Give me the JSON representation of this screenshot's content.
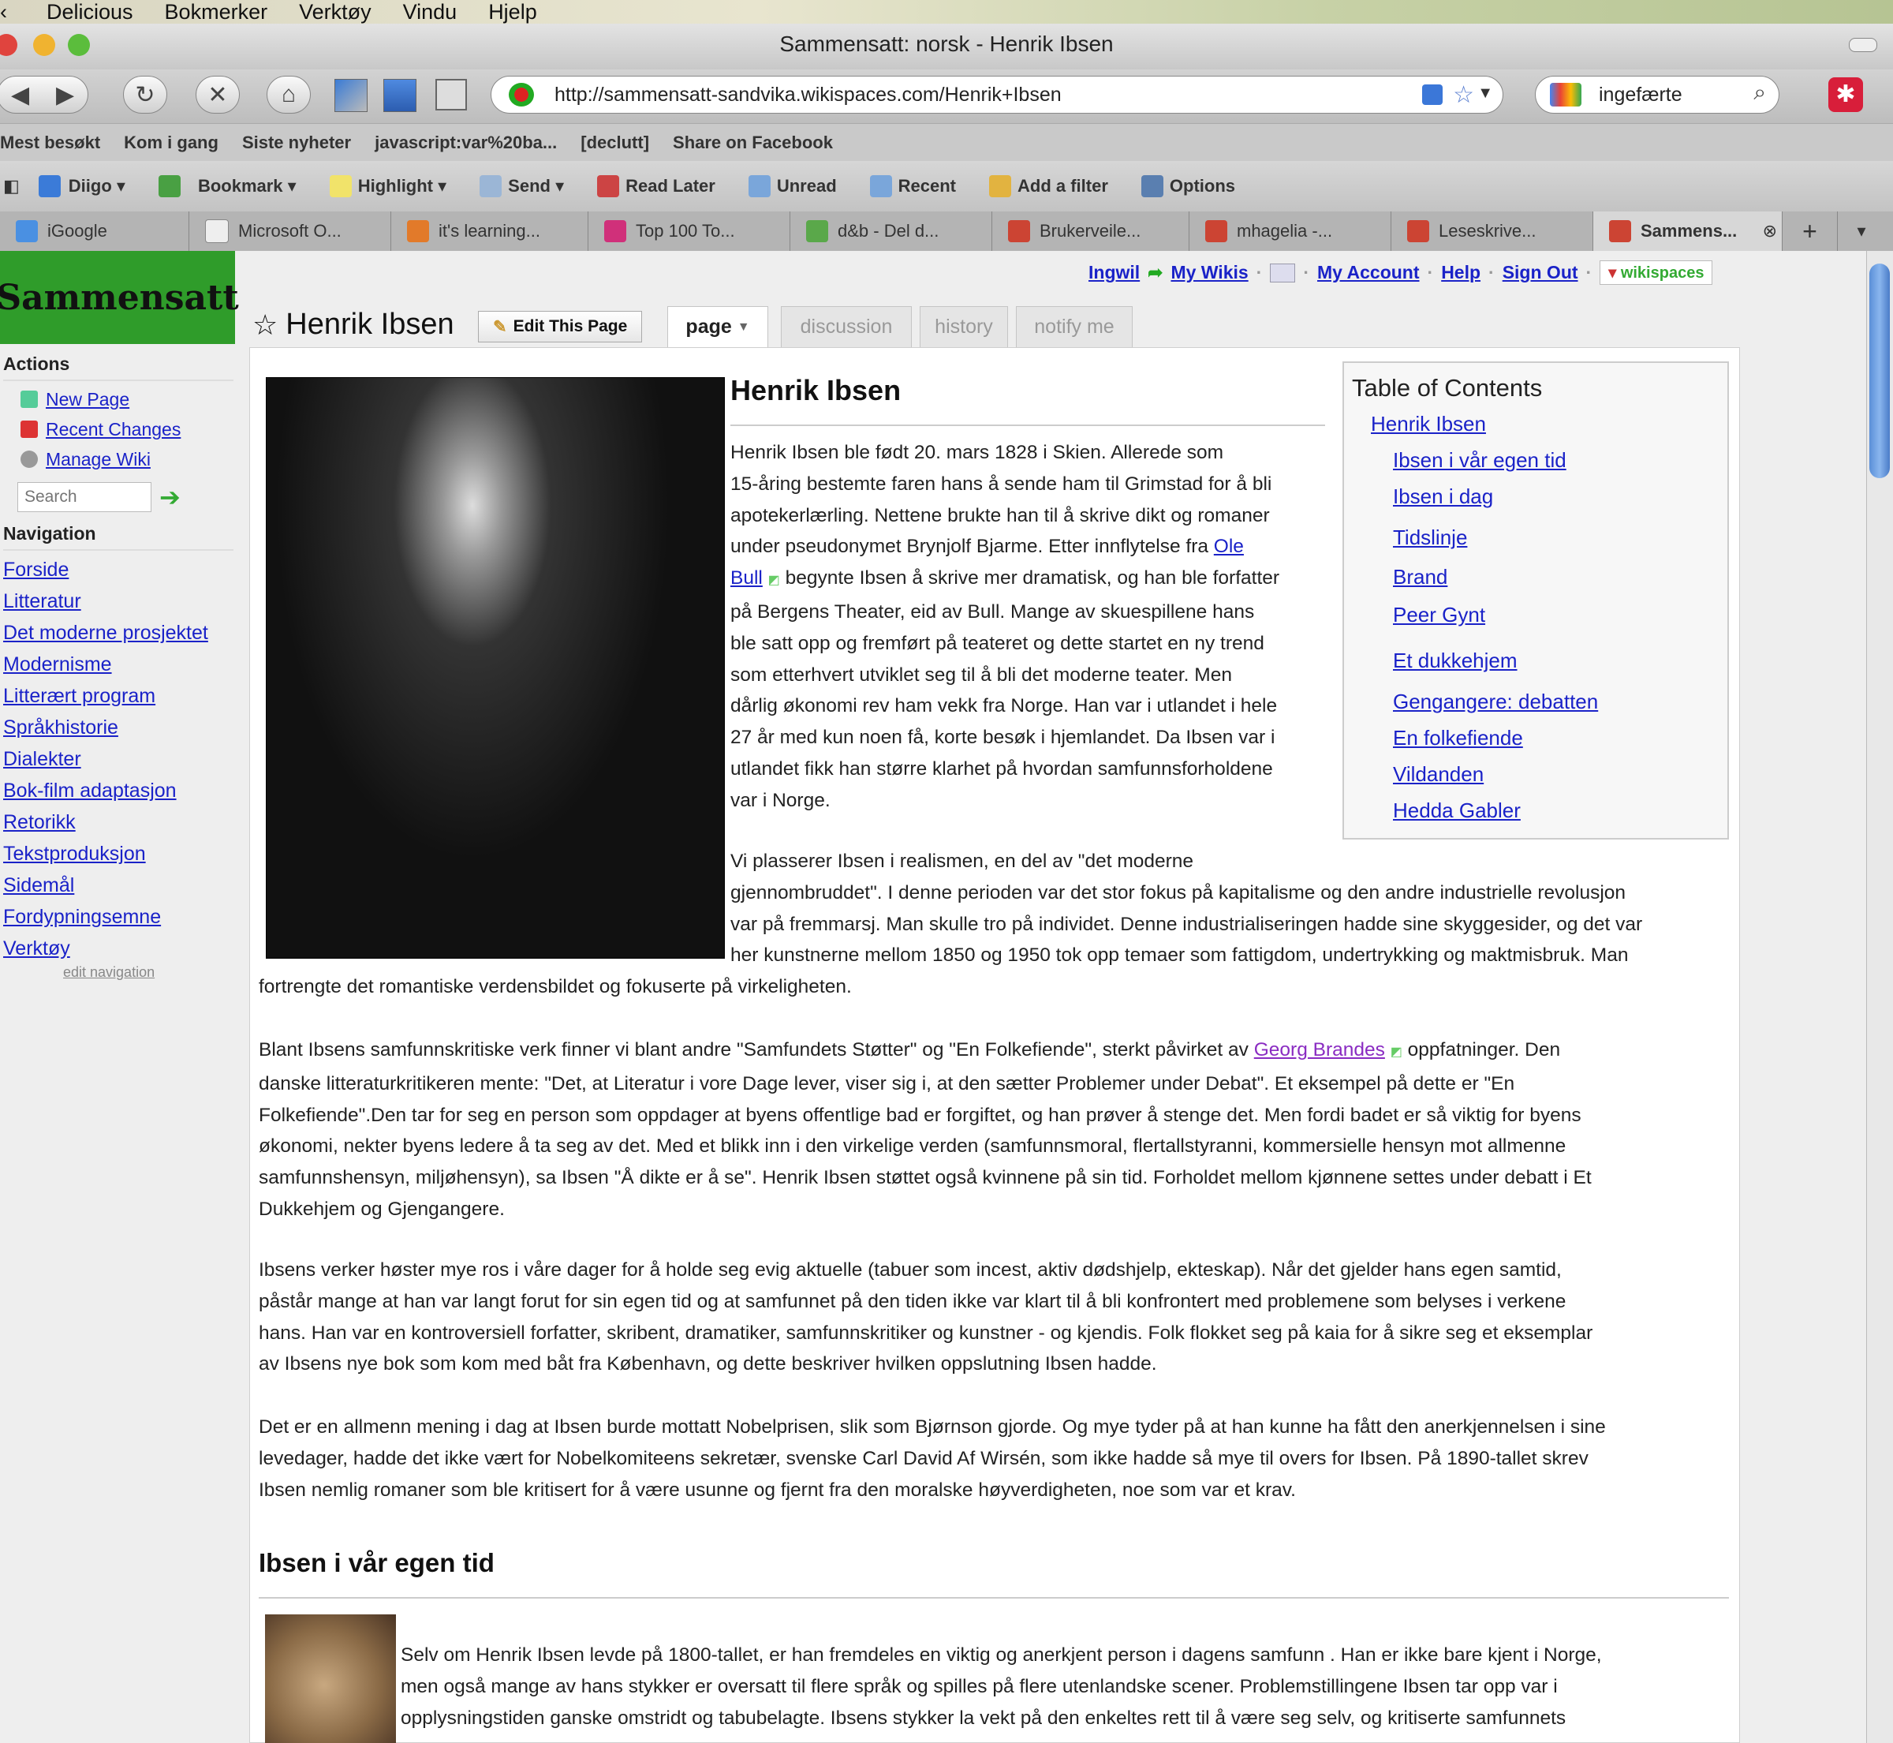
{
  "menubar": {
    "items": [
      "Delicious",
      "Bokmerker",
      "Verktøy",
      "Vindu",
      "Hjelp"
    ]
  },
  "window": {
    "title": "Sammensatt: norsk - Henrik Ibsen"
  },
  "navbar": {
    "url": "http://sammensatt-sandvika.wikispaces.com/Henrik+Ibsen",
    "search_value": "ingefærte",
    "icons": [
      "back-icon",
      "forward-icon",
      "reload-icon",
      "stop-icon",
      "home-icon"
    ]
  },
  "bookmarks": [
    "Mest besøkt",
    "Kom i gang",
    "Siste nyheter",
    "javascript:var%20ba...",
    "[declutt]",
    "Share on Facebook"
  ],
  "diigo_toolbar": [
    "Diigo",
    "Bookmark",
    "Highlight",
    "Send",
    "Read Later",
    "Unread",
    "Recent",
    "Add a filter",
    "Options"
  ],
  "tabs": [
    "iGoogle",
    "Microsoft O...",
    "it's learning...",
    "Top 100 To...",
    "d&b - Del d...",
    "Brukerveile...",
    "mhagelia -...",
    "Leseskrive...",
    "Sammens..."
  ],
  "wiki": {
    "logo": "Sammensatt",
    "user": {
      "name": "Ingwil",
      "links": [
        "My Wikis",
        "My Account",
        "Help",
        "Sign Out"
      ],
      "badge": "wikispaces"
    },
    "actions_heading": "Actions",
    "actions": [
      "New Page",
      "Recent Changes",
      "Manage Wiki"
    ],
    "search_placeholder": "Search",
    "navigation_heading": "Navigation",
    "navigation": [
      "Forside",
      "Litteratur",
      "Det moderne prosjektet",
      "Modernisme",
      "Litterært program",
      "Språkhistorie",
      "Dialekter",
      "Bok-film adaptasjon",
      "Retorikk",
      "Tekstproduksjon",
      "Sidemål",
      "Fordypningsemne",
      "Verktøy"
    ],
    "edit_navigation": "edit navigation",
    "page_title": "Henrik Ibsen",
    "edit_button": "Edit This Page",
    "page_tabs": [
      "page",
      "discussion",
      "history",
      "notify me"
    ]
  },
  "article": {
    "heading": "Henrik Ibsen",
    "p1": [
      "Henrik Ibsen ble født 20. mars 1828 i Skien. Allerede som",
      "15-åring bestemte faren hans å sende ham til Grimstad for å bli",
      "apotekerlærling. Nettene brukte han til å skrive dikt og romaner",
      "under pseudonymet Brynjolf Bjarme. Etter innflytelse fra",
      "begynte Ibsen å skrive mer dramatisk, og han ble forfatter",
      "på Bergens Theater, eid av Bull. Mange av skuespillene hans",
      "ble satt opp og fremført på teateret og dette startet en ny trend",
      "som etterhvert utviklet seg til å bli det moderne teater. Men",
      "dårlig økonomi rev ham vekk fra Norge. Han var i utlandet i hele",
      "27 år med kun noen få, korte besøk i hjemlandet. Da Ibsen var i",
      "utlandet fikk han større klarhet på hvordan samfunnsforholdene",
      "var i Norge."
    ],
    "link_ole": "Ole",
    "link_bull": "Bull",
    "p2": [
      "Vi plasserer Ibsen i realismen, en del av \"det moderne",
      "gjennombruddet\". I denne perioden var det stor fokus på kapitalisme og den andre industrielle revolusjon",
      "var på fremmarsj. Man skulle tro på individet. Denne industrialiseringen hadde sine skyggesider, og det var",
      "her kunstnerne mellom 1850 og 1950 tok opp temaer som fattigdom, undertrykking og maktmisbruk. Man",
      "fortrengte det romantiske verdensbildet og fokuserte på virkeligheten."
    ],
    "p3_pre": "Blant Ibsens samfunnskritiske verk finner vi blant andre \"Samfundets Støtter\" og \"En Folkefiende\", sterkt påvirket av",
    "link_brandes": "Georg Brandes",
    "p3_post": "oppfatninger. Den",
    "p3": [
      "danske litteraturkritikeren mente: \"Det, at Literatur i vore Dage lever, viser sig i, at den sætter Problemer under Debat\". Et eksempel på dette er \"En",
      "Folkefiende\".Den tar for seg en person som oppdager at byens offentlige bad er forgiftet, og han prøver å stenge det. Men fordi badet er så viktig for byens",
      "økonomi, nekter byens ledere å ta seg av det. Med et blikk inn i den virkelige verden (samfunnsmoral, flertallstyranni, kommersielle hensyn mot allmenne",
      "samfunnshensyn, miljøhensyn), sa Ibsen \"Å dikte er å se\". Henrik Ibsen støttet også kvinnene på sin tid. Forholdet mellom kjønnene settes under debatt i Et",
      "Dukkehjem og Gjengangere."
    ],
    "p4": [
      "Ibsens verker høster mye ros i våre dager for å holde seg evig aktuelle (tabuer som incest, aktiv dødshjelp, ekteskap). Når det gjelder hans egen samtid,",
      "påstår mange at han var langt forut for sin egen tid og at samfunnet på den tiden ikke var klart til å bli konfrontert med problemene som belyses i verkene",
      "hans. Han var en kontroversiell forfatter, skribent, dramatiker, samfunnskritiker og kunstner - og kjendis. Folk flokket seg på kaia for å sikre seg et eksemplar",
      "av Ibsens nye bok som kom med båt fra København, og dette beskriver hvilken oppslutning Ibsen hadde."
    ],
    "p5": [
      "Det er en allmenn mening i dag at Ibsen burde mottatt Nobelprisen, slik som Bjørnson gjorde. Og mye tyder på at han kunne ha fått den anerkjennelsen i sine",
      "levedager, hadde det ikke vært for Nobelkomiteens sekretær, svenske Carl David Af Wirsén, som ikke hadde så mye til overs for Ibsen. På 1890-tallet skrev",
      "Ibsen nemlig romaner som ble kritisert for å være usunne og fjernt fra den moralske høyverdigheten, noe som var et krav."
    ],
    "h2": "Ibsen i vår egen tid",
    "p6": [
      "Selv om Henrik Ibsen levde på 1800-tallet, er han fremdeles en viktig og anerkjent person i dagens samfunn . Han er ikke bare kjent i Norge,",
      "men også mange av hans stykker er oversatt til flere språk og spilles på flere utenlandske scener. Problemstillingene Ibsen tar opp var i",
      "opplysningstiden ganske omstridt og tabubelagte. Ibsens stykker la vekt på den enkeltes rett til å være seg selv, og kritiserte samfunnets"
    ]
  },
  "toc": {
    "title": "Table of Contents",
    "items": [
      "Henrik Ibsen",
      "Ibsen i vår egen tid",
      "Ibsen i dag",
      "Tidslinje",
      "Brand",
      "Peer Gynt",
      "Et dukkehjem",
      "Gengangere: debatten",
      "En folkefiende",
      "Vildanden",
      "Hedda Gabler"
    ]
  }
}
